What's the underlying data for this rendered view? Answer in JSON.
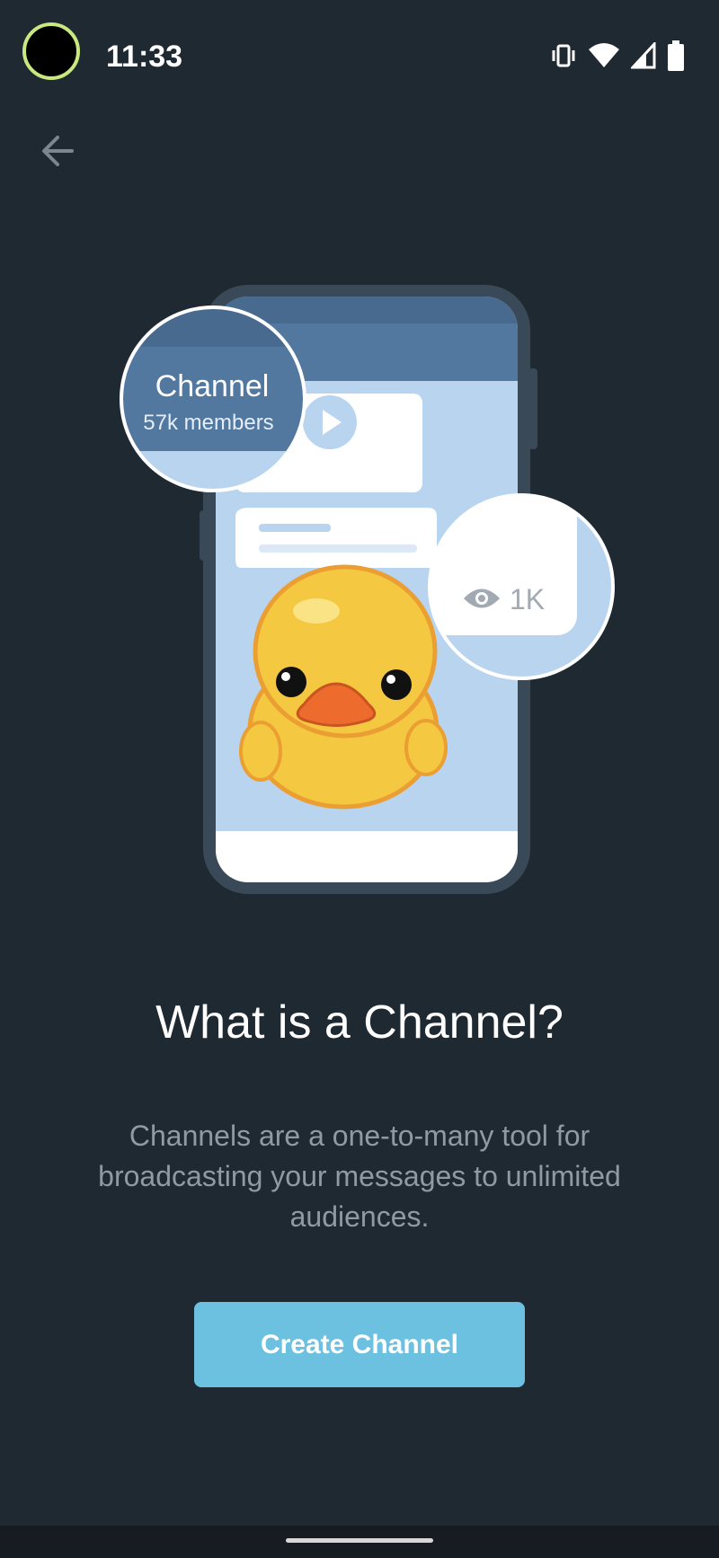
{
  "status_bar": {
    "time": "11:33",
    "icons": [
      "vibrate-icon",
      "wifi-icon",
      "signal-icon",
      "battery-icon"
    ]
  },
  "nav": {
    "back_icon": "arrow-left-icon"
  },
  "illustration": {
    "channel_name": "Channel",
    "channel_members": "57k members",
    "views": "1K",
    "icons": [
      "play-icon",
      "eye-icon",
      "duck-sticker-icon"
    ]
  },
  "main": {
    "title": "What is a Channel?",
    "description": "Channels are a one-to-many tool for broadcasting your messages to unlimited audiences.",
    "create_button": "Create Channel"
  },
  "colors": {
    "background": "#1f2931",
    "accent": "#6cc0e0",
    "phone_frame": "#3a4957",
    "header_blue": "#5378a0",
    "chat_bg": "#b8d4ef"
  }
}
